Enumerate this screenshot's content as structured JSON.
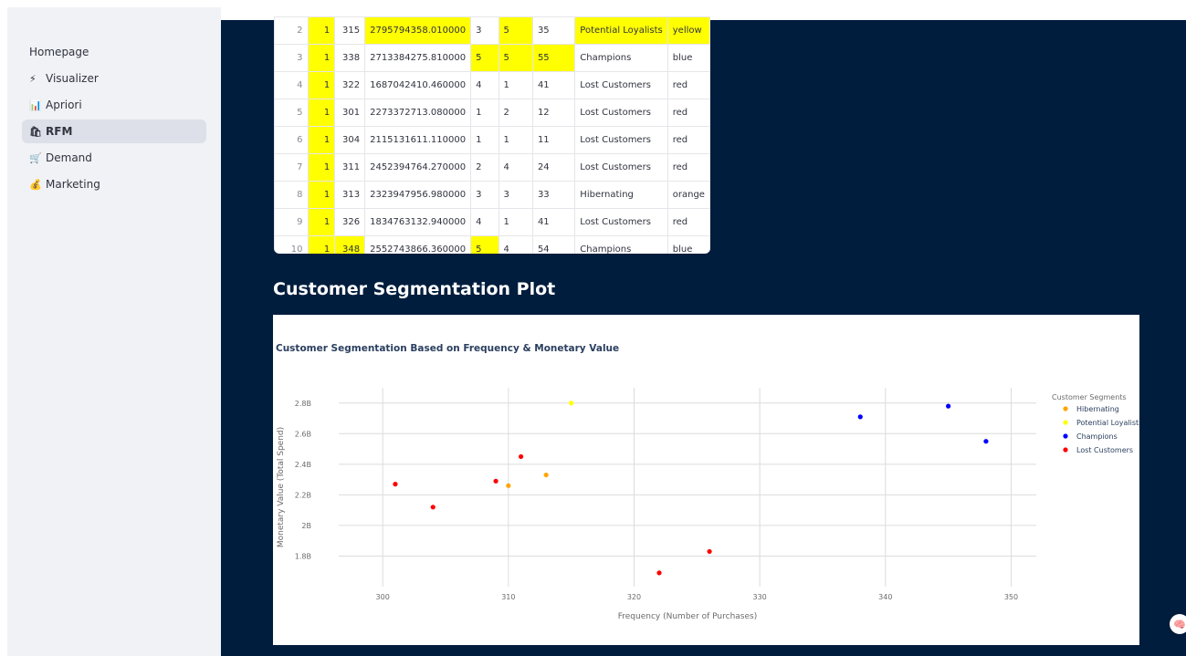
{
  "sidebar": {
    "items": [
      {
        "icon": "",
        "label": "Homepage",
        "active": false
      },
      {
        "icon": "⚡",
        "label": "Visualizer",
        "active": false
      },
      {
        "icon": "📊",
        "label": "Apriori",
        "active": false
      },
      {
        "icon": "🛍",
        "label": "RFM",
        "active": true
      },
      {
        "icon": "🛒",
        "label": "Demand",
        "active": false
      },
      {
        "icon": "💰",
        "label": "Marketing",
        "active": false
      }
    ]
  },
  "table": {
    "rows": [
      {
        "idx": "2",
        "r": "1",
        "freq": "315",
        "monetary": "2795794358.010000",
        "f_score": "3",
        "m_score": "5",
        "rfm": "35",
        "segment": "Potential Loyalists",
        "color": "yellow",
        "hl": [
          "r",
          "monetary",
          "m_score",
          "segment",
          "color"
        ]
      },
      {
        "idx": "3",
        "r": "1",
        "freq": "338",
        "monetary": "2713384275.810000",
        "f_score": "5",
        "m_score": "5",
        "rfm": "55",
        "segment": "Champions",
        "color": "blue",
        "hl": [
          "r",
          "f_score",
          "m_score",
          "rfm"
        ]
      },
      {
        "idx": "4",
        "r": "1",
        "freq": "322",
        "monetary": "1687042410.460000",
        "f_score": "4",
        "m_score": "1",
        "rfm": "41",
        "segment": "Lost Customers",
        "color": "red",
        "hl": [
          "r"
        ]
      },
      {
        "idx": "5",
        "r": "1",
        "freq": "301",
        "monetary": "2273372713.080000",
        "f_score": "1",
        "m_score": "2",
        "rfm": "12",
        "segment": "Lost Customers",
        "color": "red",
        "hl": [
          "r"
        ]
      },
      {
        "idx": "6",
        "r": "1",
        "freq": "304",
        "monetary": "2115131611.110000",
        "f_score": "1",
        "m_score": "1",
        "rfm": "11",
        "segment": "Lost Customers",
        "color": "red",
        "hl": [
          "r"
        ]
      },
      {
        "idx": "7",
        "r": "1",
        "freq": "311",
        "monetary": "2452394764.270000",
        "f_score": "2",
        "m_score": "4",
        "rfm": "24",
        "segment": "Lost Customers",
        "color": "red",
        "hl": [
          "r"
        ]
      },
      {
        "idx": "8",
        "r": "1",
        "freq": "313",
        "monetary": "2323947956.980000",
        "f_score": "3",
        "m_score": "3",
        "rfm": "33",
        "segment": "Hibernating",
        "color": "orange",
        "hl": [
          "r"
        ]
      },
      {
        "idx": "9",
        "r": "1",
        "freq": "326",
        "monetary": "1834763132.940000",
        "f_score": "4",
        "m_score": "1",
        "rfm": "41",
        "segment": "Lost Customers",
        "color": "red",
        "hl": [
          "r"
        ]
      },
      {
        "idx": "10",
        "r": "1",
        "freq": "348",
        "monetary": "2552743866.360000",
        "f_score": "5",
        "m_score": "4",
        "rfm": "54",
        "segment": "Champions",
        "color": "blue",
        "hl": [
          "r",
          "freq",
          "f_score"
        ]
      }
    ]
  },
  "section_title": "Customer Segmentation Plot",
  "chart_data": {
    "type": "scatter",
    "title": "Customer Segmentation Based on Frequency & Monetary Value",
    "xlabel": "Frequency (Number of Purchases)",
    "ylabel": "Monetary Value (Total Spend)",
    "xlim": [
      296.5,
      352
    ],
    "ylim": [
      1600000000.0,
      2900000000.0
    ],
    "xticks": [
      300,
      310,
      320,
      330,
      340,
      350
    ],
    "yticks": [
      {
        "v": 1800000000.0,
        "label": "1.8B"
      },
      {
        "v": 2000000000.0,
        "label": "2B"
      },
      {
        "v": 2200000000.0,
        "label": "2.2B"
      },
      {
        "v": 2400000000.0,
        "label": "2.4B"
      },
      {
        "v": 2600000000.0,
        "label": "2.6B"
      },
      {
        "v": 2800000000.0,
        "label": "2.8B"
      }
    ],
    "grid": true,
    "legend_title": "Customer Segments",
    "legend_position": "right",
    "series": [
      {
        "name": "Hibernating",
        "color": "#ffa500",
        "points": [
          [
            310,
            2260000000.0
          ],
          [
            313,
            2330000000.0
          ]
        ]
      },
      {
        "name": "Potential Loyalists",
        "color": "#ffff00",
        "points": [
          [
            315,
            2800000000.0
          ]
        ]
      },
      {
        "name": "Champions",
        "color": "#0000ff",
        "points": [
          [
            338,
            2710000000.0
          ],
          [
            345,
            2780000000.0
          ],
          [
            348,
            2550000000.0
          ]
        ]
      },
      {
        "name": "Lost Customers",
        "color": "#ff0000",
        "points": [
          [
            301,
            2270000000.0
          ],
          [
            304,
            2120000000.0
          ],
          [
            309,
            2290000000.0
          ],
          [
            311,
            2450000000.0
          ],
          [
            322,
            1690000000.0
          ],
          [
            326,
            1830000000.0
          ]
        ]
      }
    ]
  },
  "fab_icon": "🧠"
}
